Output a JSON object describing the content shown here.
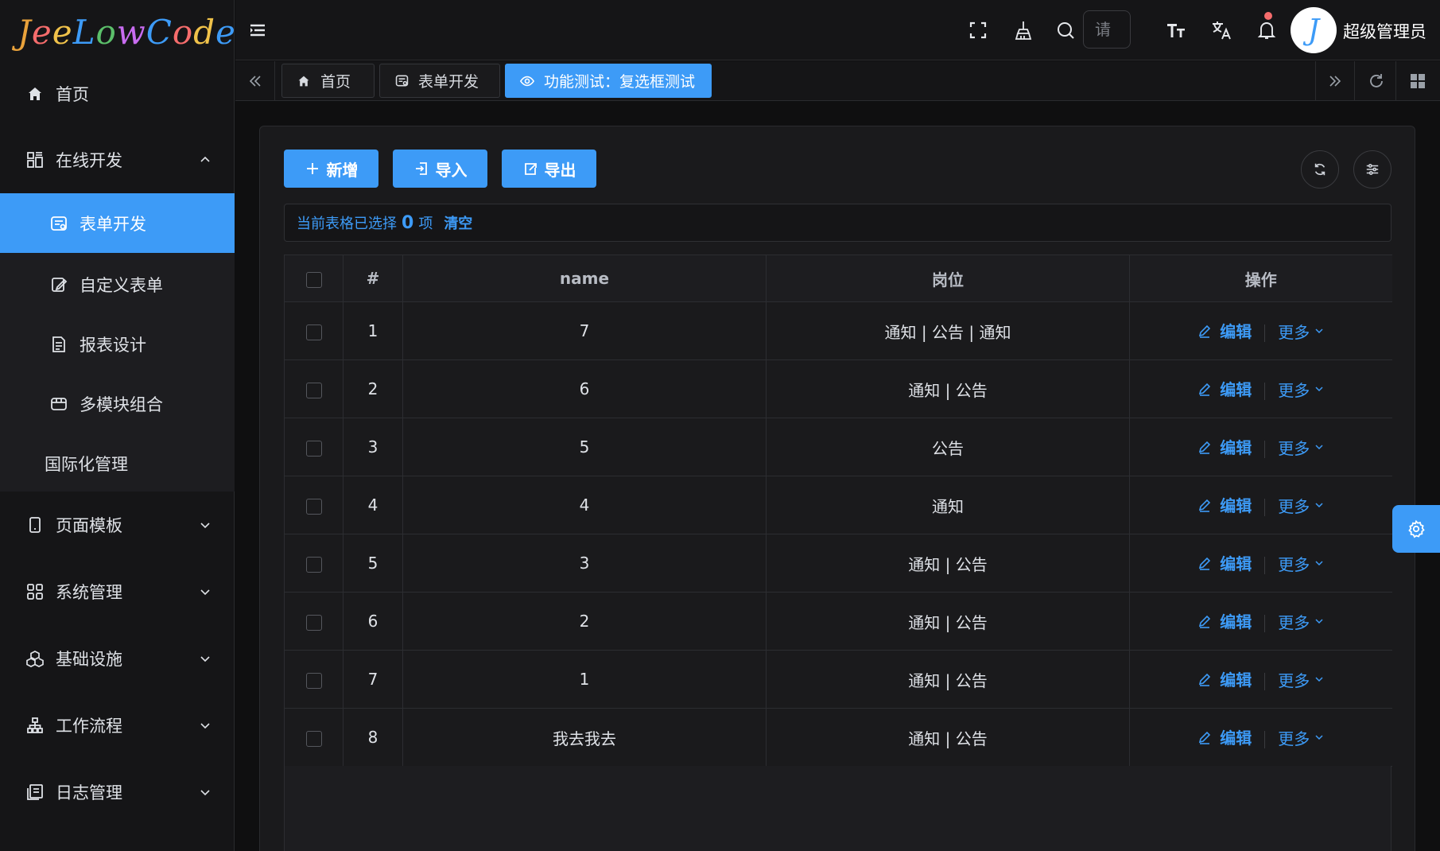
{
  "app": {
    "logo_text": "JeeLowCode",
    "logo_colors": [
      "#e9a23b",
      "#f56c6c",
      "#f0c24a",
      "#3d9bf7",
      "#5bbf6a",
      "#c86cf0",
      "#3d9bf7",
      "#f56c6c",
      "#f0c24a",
      "#3d9bf7"
    ]
  },
  "sidebar": {
    "home": "首页",
    "online_dev": "在线开发",
    "sub_items": [
      {
        "label": "表单开发",
        "icon": "form-icon"
      },
      {
        "label": "自定义表单",
        "icon": "edit-form-icon"
      },
      {
        "label": "报表设计",
        "icon": "report-icon"
      },
      {
        "label": "多模块组合",
        "icon": "modules-icon"
      }
    ],
    "i18n": "国际化管理",
    "groups": [
      {
        "label": "页面模板",
        "icon": "tablet-icon"
      },
      {
        "label": "系统管理",
        "icon": "grid-icon"
      },
      {
        "label": "基础设施",
        "icon": "cubes-icon"
      },
      {
        "label": "工作流程",
        "icon": "flow-icon"
      },
      {
        "label": "日志管理",
        "icon": "log-icon"
      }
    ]
  },
  "header": {
    "search_placeholder": "请",
    "username": "超级管理员",
    "avatar_letter": "J"
  },
  "tabs": [
    {
      "label": "首页",
      "icon": "home-icon"
    },
    {
      "label": "表单开发",
      "icon": "form-icon"
    },
    {
      "label": "功能测试：复选框测试",
      "icon": "eye-icon"
    }
  ],
  "toolbar": {
    "add": "新增",
    "import": "导入",
    "export": "导出"
  },
  "selection": {
    "prefix": "当前表格已选择",
    "count": "0",
    "suffix": "项",
    "clear": "清空"
  },
  "table": {
    "columns": [
      "#",
      "name",
      "岗位",
      "操作"
    ],
    "edit_label": "编辑",
    "more_label": "更多",
    "rows": [
      {
        "index": "1",
        "name": "7",
        "post": "通知 | 公告 | 通知"
      },
      {
        "index": "2",
        "name": "6",
        "post": "通知 | 公告"
      },
      {
        "index": "3",
        "name": "5",
        "post": "公告"
      },
      {
        "index": "4",
        "name": "4",
        "post": "通知"
      },
      {
        "index": "5",
        "name": "3",
        "post": "通知 | 公告"
      },
      {
        "index": "6",
        "name": "2",
        "post": "通知 | 公告"
      },
      {
        "index": "7",
        "name": "1",
        "post": "通知 | 公告"
      },
      {
        "index": "8",
        "name": "我去我去",
        "post": "通知 | 公告"
      }
    ]
  },
  "colors": {
    "accent": "#3d9bf7",
    "notification_dot": "#f56c6c"
  }
}
